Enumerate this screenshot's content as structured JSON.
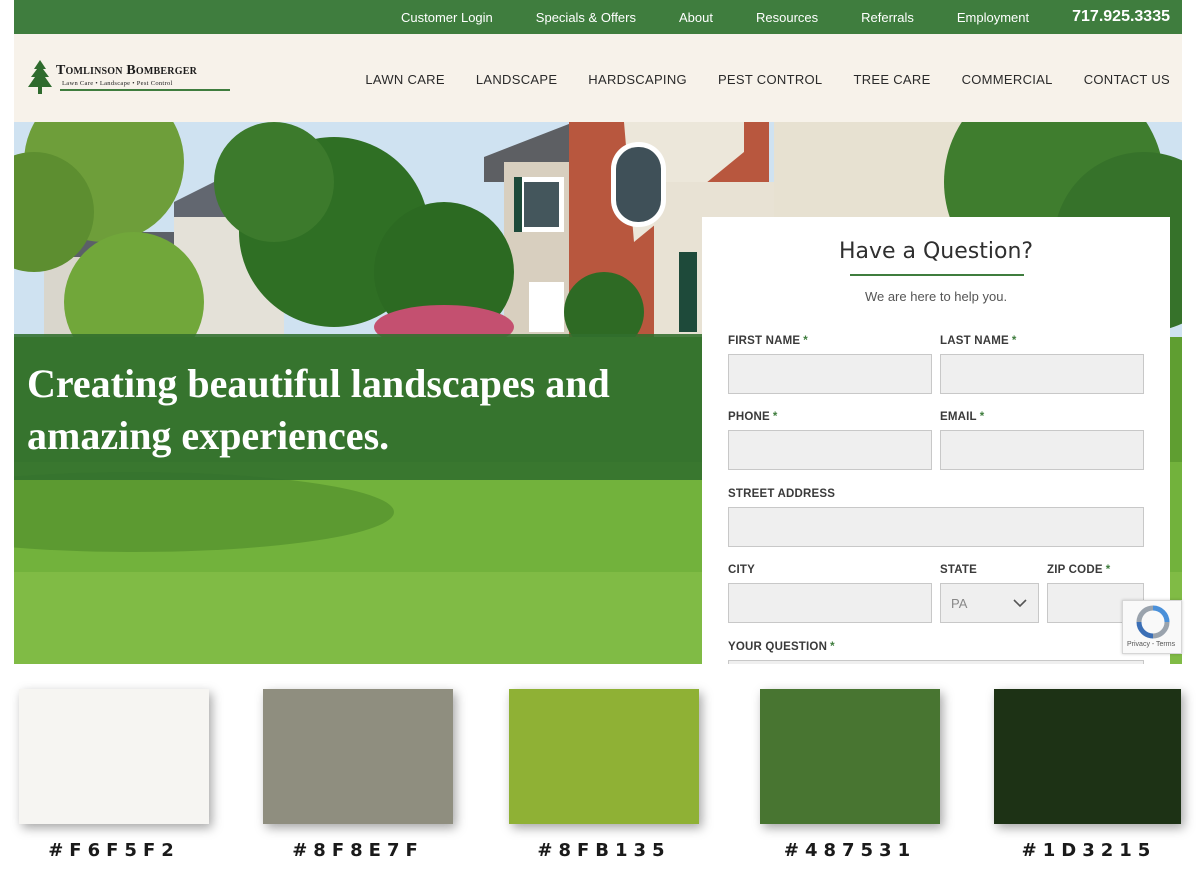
{
  "topbar": {
    "links": [
      "Customer Login",
      "Specials & Offers",
      "About",
      "Resources",
      "Referrals",
      "Employment"
    ],
    "phone": "717.925.3335"
  },
  "logo": {
    "name": "Tomlinson Bomberger",
    "tagline": "Lawn Care • Landscape • Pest Control"
  },
  "nav": {
    "items": [
      "LAWN CARE",
      "LANDSCAPE",
      "HARDSCAPING",
      "PEST CONTROL",
      "TREE CARE",
      "COMMERCIAL",
      "CONTACT US"
    ]
  },
  "hero": {
    "headline": "Creating beautiful landscapes and amazing experiences."
  },
  "form": {
    "title": "Have a Question?",
    "subtitle": "We are here to help you.",
    "required_mark": "*",
    "labels": {
      "first_name": "FIRST NAME",
      "last_name": "LAST NAME",
      "phone": "PHONE",
      "email": "EMAIL",
      "street": "STREET ADDRESS",
      "city": "CITY",
      "state": "STATE",
      "zip": "ZIP CODE",
      "question": "YOUR QUESTION"
    },
    "state_value": "PA"
  },
  "recaptcha": {
    "text": "Privacy - Terms"
  },
  "palette": [
    {
      "hex": "#F6F5F2",
      "label": "#F6F5F2"
    },
    {
      "hex": "#8F8E7F",
      "label": "#8F8E7F"
    },
    {
      "hex": "#8FB135",
      "label": "#8FB135"
    },
    {
      "hex": "#487531",
      "label": "#487531"
    },
    {
      "hex": "#1D3215",
      "label": "#1D3215"
    }
  ],
  "colors": {
    "brand_green": "#3f7d3e",
    "header_bg": "#f7f2ea",
    "field_bg": "#efefef"
  }
}
